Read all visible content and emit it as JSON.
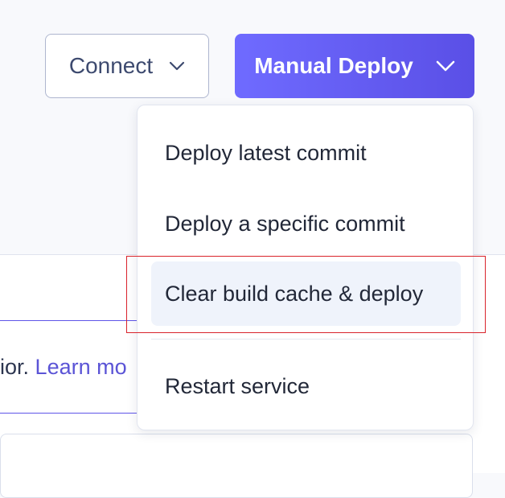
{
  "header": {
    "connect_label": "Connect",
    "deploy_label": "Manual Deploy"
  },
  "menu": {
    "items": [
      {
        "label": "Deploy latest commit"
      },
      {
        "label": "Deploy a specific commit"
      },
      {
        "label": "Clear build cache & deploy"
      },
      {
        "label": "Restart service"
      }
    ]
  },
  "banner": {
    "text": "ior.",
    "link_text": "Learn mo"
  },
  "colors": {
    "accent": "#5f55e8",
    "annotation": "#d9232b",
    "highlight": "#eff3fb"
  },
  "icons": {
    "connect_chevron": "chevron-down-icon",
    "deploy_chevron": "chevron-down-icon"
  }
}
